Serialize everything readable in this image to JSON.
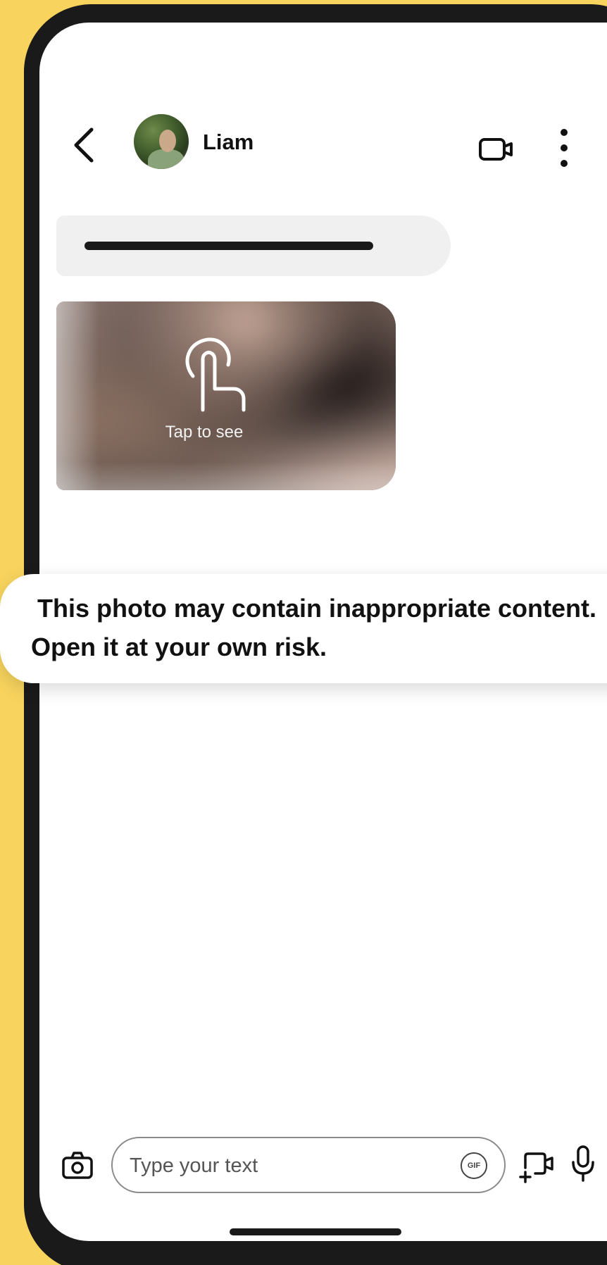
{
  "header": {
    "contact_name": "Liam"
  },
  "messages": {
    "photo_label": "Tap to see"
  },
  "warning": {
    "line1": "This photo may contain inappropriate content.",
    "line2": "Open it at your own risk."
  },
  "composer": {
    "placeholder": "Type your text",
    "gif_label": "GIF"
  },
  "icons": {
    "back": "chevron-left-icon",
    "video_call": "video-camera-icon",
    "more": "more-vertical-icon",
    "tap": "tap-finger-icon",
    "camera": "camera-icon",
    "gif": "gif-icon",
    "add_video": "add-video-icon",
    "mic": "microphone-icon"
  },
  "colors": {
    "background": "#F8D45E",
    "bubble": "#f0f0f0"
  }
}
